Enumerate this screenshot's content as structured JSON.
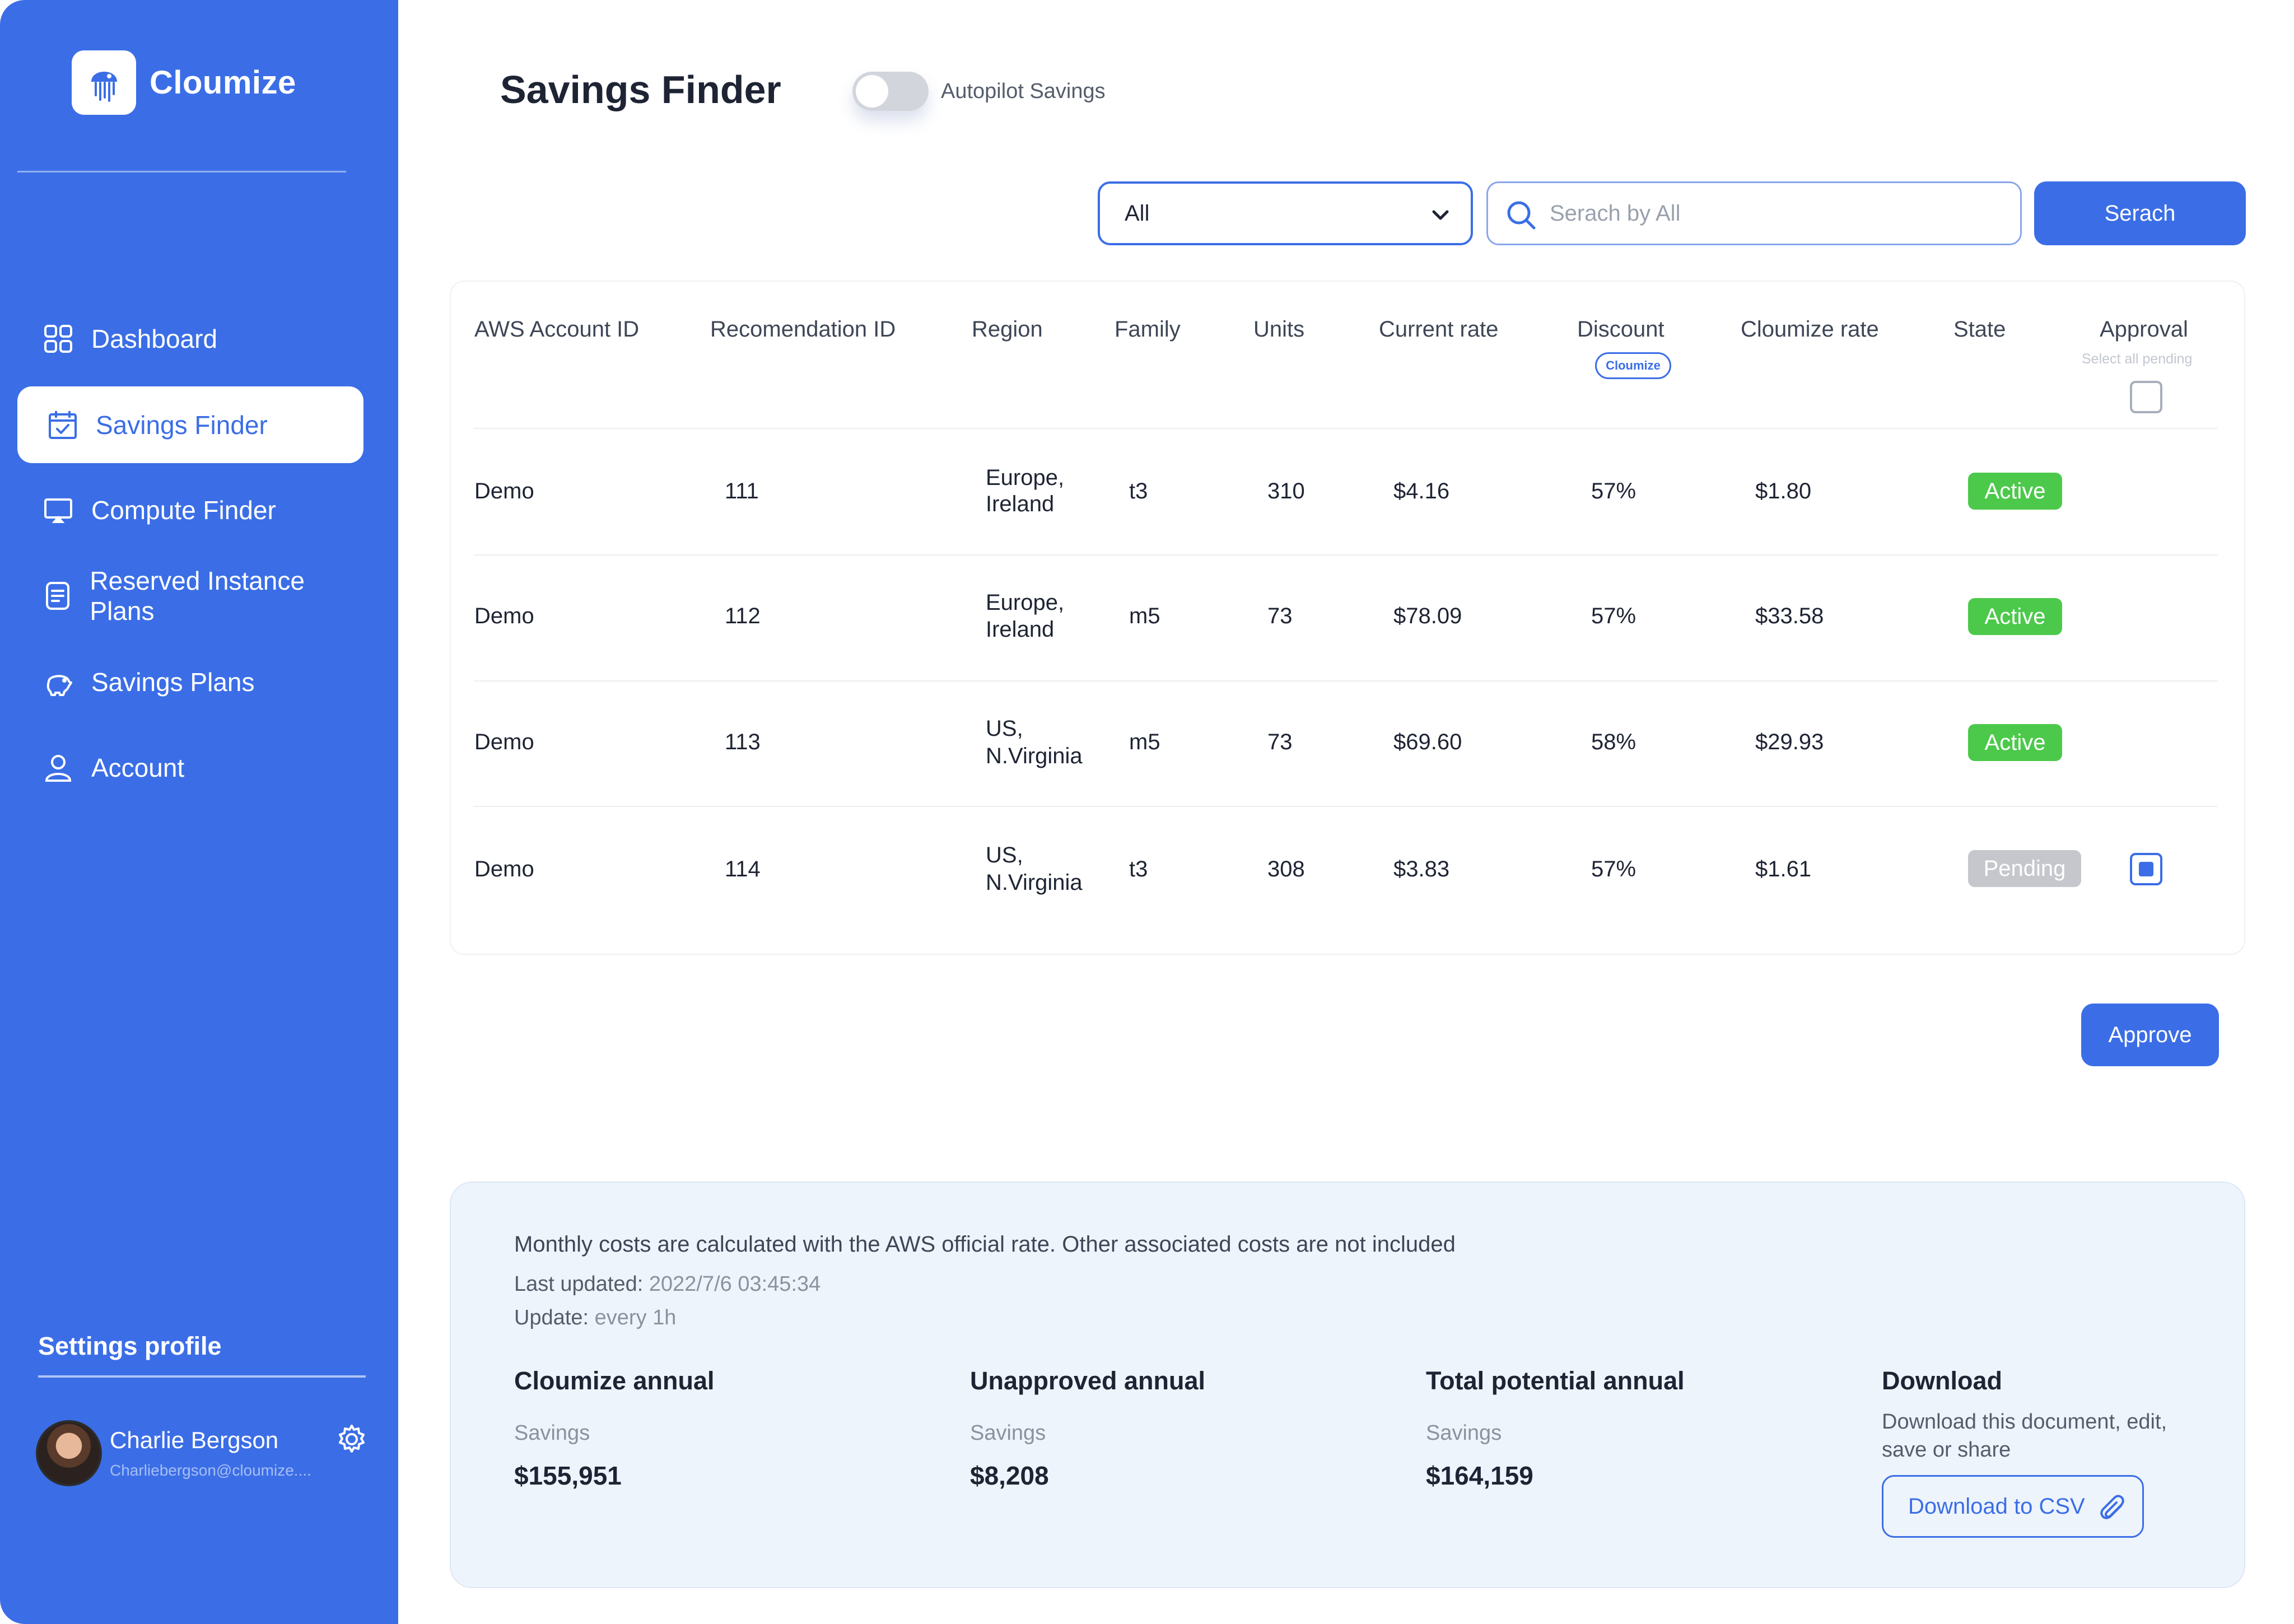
{
  "app": {
    "name": "Cloumize"
  },
  "sidebar": {
    "items": [
      {
        "label": "Dashboard",
        "icon": "grid-icon"
      },
      {
        "label": "Savings Finder",
        "icon": "calendar-check-icon"
      },
      {
        "label": "Compute Finder",
        "icon": "monitor-icon"
      },
      {
        "label": "Reserved Instance Plans",
        "icon": "document-icon"
      },
      {
        "label": "Savings Plans",
        "icon": "piggy-bank-icon"
      },
      {
        "label": "Account",
        "icon": "user-icon"
      }
    ],
    "settings_title": "Settings profile",
    "profile": {
      "name": "Charlie Bergson",
      "email": "Charliebergson@cloumize...."
    }
  },
  "header": {
    "title": "Savings Finder",
    "autopilot_label": "Autopilot Savings"
  },
  "filters": {
    "select_value": "All",
    "search_placeholder": "Serach by All",
    "search_button": "Serach"
  },
  "table": {
    "headers": {
      "account": "AWS Account ID",
      "recommendation": "Recomendation ID",
      "region": "Region",
      "family": "Family",
      "units": "Units",
      "current_rate": "Current rate",
      "discount": "Discount",
      "discount_badge": "Cloumize",
      "cloumize_rate": "Cloumize rate",
      "state": "State",
      "approval": "Approval",
      "select_all": "Select all pending"
    },
    "rows": [
      {
        "account": "Demo",
        "id": "111",
        "region_line1": "Europe,",
        "region_line2": "Ireland",
        "family": "t3",
        "units": "310",
        "current_rate": "$4.16",
        "discount": "57%",
        "cloumize_rate": "$1.80",
        "state": "Active"
      },
      {
        "account": "Demo",
        "id": "112",
        "region_line1": "Europe,",
        "region_line2": "Ireland",
        "family": "m5",
        "units": "73",
        "current_rate": "$78.09",
        "discount": "57%",
        "cloumize_rate": "$33.58",
        "state": "Active"
      },
      {
        "account": "Demo",
        "id": "113",
        "region_line1": "US,",
        "region_line2": "N.Virginia",
        "family": "m5",
        "units": "73",
        "current_rate": "$69.60",
        "discount": "58%",
        "cloumize_rate": "$29.93",
        "state": "Active"
      },
      {
        "account": "Demo",
        "id": "114",
        "region_line1": "US,",
        "region_line2": "N.Virginia",
        "family": "t3",
        "units": "308",
        "current_rate": "$3.83",
        "discount": "57%",
        "cloumize_rate": "$1.61",
        "state": "Pending"
      }
    ],
    "approve_button": "Approve"
  },
  "summary": {
    "note": "Monthly costs are calculated with the AWS official rate. Other associated costs are not included",
    "last_updated_label": "Last updated:",
    "last_updated_value": "2022/7/6 03:45:34",
    "update_label": "Update:",
    "update_value": "every 1h",
    "stats": [
      {
        "title": "Cloumize annual",
        "sub": "Savings",
        "value": "$155,951"
      },
      {
        "title": "Unapproved annual",
        "sub": "Savings",
        "value": "$8,208"
      },
      {
        "title": "Total potential annual",
        "sub": "Savings",
        "value": "$164,159"
      }
    ],
    "download_title": "Download",
    "download_desc": "Download this document, edit, save or share",
    "download_button": "Download to CSV"
  },
  "colors": {
    "accent": "#3b6ee6",
    "active": "#4cc94b",
    "pending": "#c5c7cc",
    "panel": "#eef4fc"
  }
}
